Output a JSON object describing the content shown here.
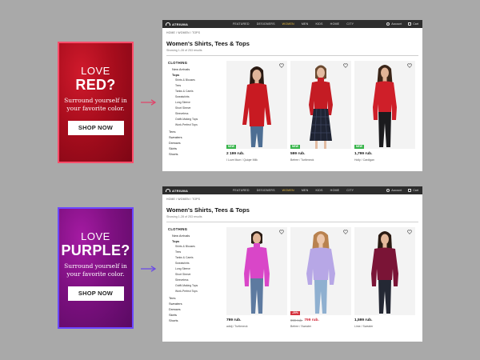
{
  "banners": [
    {
      "love": "LOVE",
      "color": "RED?",
      "sub": "Surround yourself in your favorite color.",
      "cta": "SHOP NOW"
    },
    {
      "love": "LOVE",
      "color": "PURPLE?",
      "sub": "Surround yourself in your favorite color.",
      "cta": "SHOP NOW"
    }
  ],
  "pages": [
    {
      "logo": "ATRIUMA",
      "nav": [
        "FEATURED",
        "DESIGNERS",
        "WOMEN",
        "MEN",
        "KIDS",
        "HOME",
        "CITY"
      ],
      "account": "Account",
      "cart": "Cart",
      "breadcrumb": "HOME / WOMEN / TOPS",
      "title": "Women's Shirts, Tees & Tops",
      "showing": "Showing 1-28 of 253 results",
      "side": {
        "heading": "CLOTHING",
        "new": "New Arrivals",
        "tops": "Tops",
        "subs": [
          "Shirts & Blouses",
          "Tees",
          "Tanks & Camis",
          "Sweatshirts",
          "Long Sleeve",
          "Short Sleeve",
          "Sleeveless",
          "Outfit-Making Tops",
          "Work-Perfect Tops"
        ],
        "more": [
          "Tees",
          "Sweaters",
          "Dresses",
          "Skirts",
          "Shorts"
        ]
      },
      "products": [
        {
          "price": "2 199 rub.",
          "brand": "I Love Mum / Quiqer Milk",
          "tag": "NEW"
        },
        {
          "price": "599 rub.",
          "brand": "Befree / Turtleneck",
          "tag": "NEW"
        },
        {
          "price": "1,799 rub.",
          "brand": "Holly / Cardigan",
          "tag": "NEW"
        }
      ]
    },
    {
      "logo": "ATRIUMA",
      "nav": [
        "FEATURED",
        "DESIGNERS",
        "WOMEN",
        "MEN",
        "KIDS",
        "HOME",
        "CITY"
      ],
      "account": "Account",
      "cart": "Cart",
      "breadcrumb": "HOME / WOMEN / TOPS",
      "title": "Women's Shirts, Tees & Tops",
      "showing": "Showing 1-28 of 253 results",
      "side": {
        "heading": "CLOTHING",
        "new": "New Arrivals",
        "tops": "Tops",
        "subs": [
          "Shirts & Blouses",
          "Tees",
          "Tanks & Camis",
          "Sweatshirts",
          "Long Sleeve",
          "Short Sleeve",
          "Sleeveless",
          "Outfit-Making Tops",
          "Work-Perfect Tops"
        ],
        "more": [
          "Tees",
          "Sweaters",
          "Dresses",
          "Skirts",
          "Shorts"
        ]
      },
      "products": [
        {
          "price": "799 rub.",
          "brand": "adidj / Turtleneck",
          "tag": ""
        },
        {
          "price": "799 rub.",
          "old_price": "999 rub.",
          "brand": "Befree / Sweater",
          "tag": "-20%"
        },
        {
          "price": "1,599 rub.",
          "brand": "Lime / Sweater",
          "tag": ""
        }
      ]
    }
  ],
  "colors": {
    "red_shirt": "#c81a22",
    "purple_top_pink": "#d946c8",
    "lavender": "#b7a7e6",
    "burgundy": "#7a1436",
    "new_tag": "#37b44a",
    "sale_tag": "#d5323e",
    "nav_active": "#f0c040"
  }
}
